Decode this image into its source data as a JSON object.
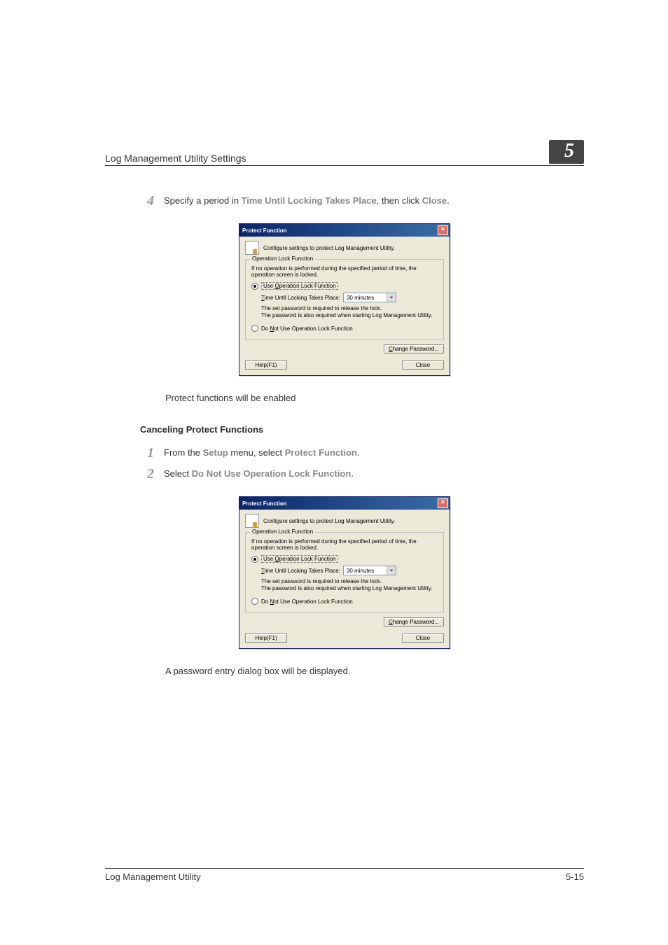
{
  "header": {
    "running_title": "Log Management Utility Settings",
    "chapter": "5"
  },
  "step4": {
    "num": "4",
    "pre": "Specify a period in ",
    "emph1": "Time Until Locking Takes Place",
    "mid": ", then click ",
    "emph2": "Close",
    "post": "."
  },
  "dialog1": {
    "title": "Protect Function",
    "close_glyph": "✕",
    "desc": "Configure settings to protect Log Management Utility.",
    "group_legend": "Operation Lock Function",
    "intro": "If no operation is performed during the specified period of time, the operation screen is locked.",
    "radio_use_pre": "Use ",
    "radio_use_u": "O",
    "radio_use_post": "peration Lock Function",
    "time_label_pre": "",
    "time_label_u": "T",
    "time_label_post": "ime Until Locking Takes Place:",
    "time_value": "30 minutes",
    "note1": "The set password is required to release the lock.",
    "note2": "The password is also required when starting Log Management Utility.",
    "radio_nouse_pre": "Do ",
    "radio_nouse_u": "N",
    "radio_nouse_post": "ot Use Operation Lock Function",
    "change_pw_pre": "",
    "change_pw_u": "C",
    "change_pw_post": "hange Password...",
    "help": "Help(F1)",
    "close": "Close"
  },
  "after_dialog1": "Protect functions will be enabled",
  "cancel_heading": "Canceling Protect Functions",
  "cancel_step1": {
    "num": "1",
    "pre": "From the ",
    "emph1": "Setup",
    "mid": " menu, select ",
    "emph2": "Protect Function",
    "post": "."
  },
  "cancel_step2": {
    "num": "2",
    "pre": "Select ",
    "emph1": "Do Not Use Operation Lock Function",
    "post": "."
  },
  "after_dialog2": "A password entry dialog box will be displayed.",
  "footer": {
    "product": "Log Management Utility",
    "page": "5-15"
  }
}
